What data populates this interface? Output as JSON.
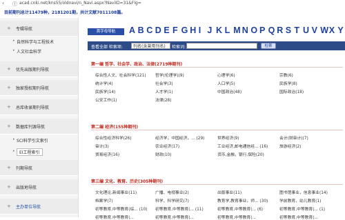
{
  "browser": {
    "url": "acad.cnki.net/kns55/oldnavi/n_Navi.aspx?NaviID=31&Flg="
  },
  "info_text": "目前期刊总计11479种，2181201期，共计文献7011108篇。",
  "sidebar": {
    "items": [
      {
        "label": "专辑导航",
        "subitems": [
          "自然科学与工程技术",
          "人文社会科学"
        ]
      },
      {
        "label": "优先出版期刊导航"
      },
      {
        "label": "独家授权期刊导航"
      },
      {
        "label": "总库收录期刊导航"
      },
      {
        "label": "数据库刊源导航",
        "subitems": [
          "SCI科学引文索引",
          "EI工程索引"
        ]
      },
      {
        "label": "刊期导航"
      },
      {
        "label": "出版地导航"
      },
      {
        "label": "主办单位导航"
      }
    ]
  },
  "letters": {
    "tag": "首字母导航",
    "list": [
      "A",
      "B",
      "C",
      "D",
      "E",
      "F",
      "G",
      "H",
      "I",
      "J",
      "K",
      "L",
      "M",
      "N",
      "O",
      "P",
      "Q",
      "R",
      "S",
      "T",
      "U",
      "V",
      "W",
      "X",
      "Y"
    ]
  },
  "search": {
    "scope_label": "查看全部  检索项:",
    "field_value": "刊名(含曾用刊名)",
    "term_label": "检索词:",
    "button": "检索"
  },
  "sections": [
    {
      "title": "第一编 哲学、社会学、政治、法律(2719种期刊)",
      "rows": [
        [
          "综合性人文、社会科学(121)",
          "哲学(伦理学)(9)",
          "心理学(6)",
          "宗教(6)"
        ],
        [
          "统计学(4)",
          "社会学(3)",
          "人口学(5)",
          "民族学(8)"
        ],
        [
          "民族学(14)",
          "人才学(1)",
          "中国政治(48)",
          "国际政治(18)"
        ],
        [
          "公安工作(1)",
          "法律(28)",
          "",
          ""
        ]
      ]
    },
    {
      "title": "第二编 经济(155种期刊)",
      "rows": [
        [
          "综合性经济科学(26)",
          "经济学，中国经济，... (29)",
          "世界经济(9)",
          "会计(财审计)(7)"
        ],
        [
          "审计(3)",
          "农业经济(17)",
          "工业经济,邮电通信经... (16)",
          "旅游经济(2)"
        ],
        [
          "贸易经济(16)",
          "财政(10)",
          "货币,金融，银行,保险(20)",
          ""
        ]
      ]
    },
    {
      "title": "第三编 文化、教育、历史(305种期刊)",
      "rows": [
        [
          "文化理论,新闻事业(11)",
          "广播、电视事业(2)",
          "出版事业(11)",
          "图书馆事业，信息事业(14)"
        ],
        [
          "档案学(7)",
          "科学、科学研究(7)",
          "教育学,教育事业，师... (30)",
          "学前教育、幼儿教育(1)"
        ],
        [
          "初等教育,中等教育(综... (10)",
          "初等教育,中等教育(... (11)",
          "初等教育,中等教育(... (6)",
          "初等教育,中等教育(... (1)"
        ],
        [
          "初等教育,中等教育(... ",
          "初等教育,中等教育(... ",
          "初等教育,中等教育(... ",
          "初等教育,中等教育(... "
        ]
      ]
    }
  ]
}
